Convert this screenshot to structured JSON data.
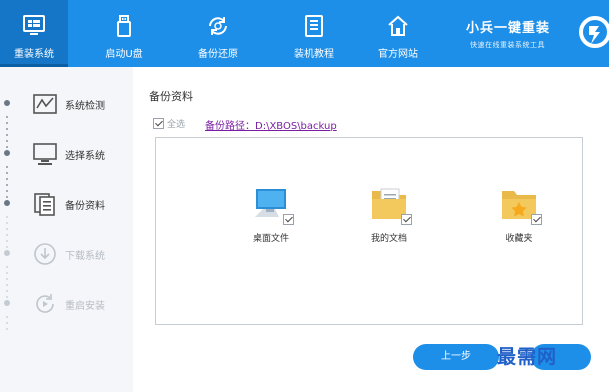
{
  "nav": {
    "items": [
      {
        "label": "重装系统",
        "icon": "monitor-icon",
        "active": true
      },
      {
        "label": "启动U盘",
        "icon": "usb-icon",
        "active": false
      },
      {
        "label": "备份还原",
        "icon": "backup-icon",
        "active": false
      },
      {
        "label": "装机教程",
        "icon": "book-icon",
        "active": false
      },
      {
        "label": "官方网站",
        "icon": "home-icon",
        "active": false
      }
    ],
    "brand_title": "小兵一键重装",
    "brand_subtitle": "快速在线重装系统工具"
  },
  "steps": [
    {
      "label": "系统检测",
      "icon": "chart-icon",
      "state": "done"
    },
    {
      "label": "选择系统",
      "icon": "desktop-icon",
      "state": "done"
    },
    {
      "label": "备份资料",
      "icon": "document-icon",
      "state": "current"
    },
    {
      "label": "下载系统",
      "icon": "download-icon",
      "state": "pending"
    },
    {
      "label": "重启安装",
      "icon": "restart-icon",
      "state": "pending"
    }
  ],
  "main": {
    "section_title": "备份资料",
    "select_all_label": "全选",
    "backup_path": "备份路径：D:\\XBOS\\backup",
    "files": [
      {
        "label": "桌面文件",
        "icon": "desktop-file-icon",
        "checked": true
      },
      {
        "label": "我的文档",
        "icon": "documents-folder-icon",
        "checked": true
      },
      {
        "label": "收藏夹",
        "icon": "favorites-folder-icon",
        "checked": true
      }
    ],
    "prev_button": "上一步"
  },
  "watermark": "最需网",
  "colors": {
    "primary": "#1e8fe8",
    "active_nav": "#1576c7",
    "path_link": "#7a1fa2"
  }
}
